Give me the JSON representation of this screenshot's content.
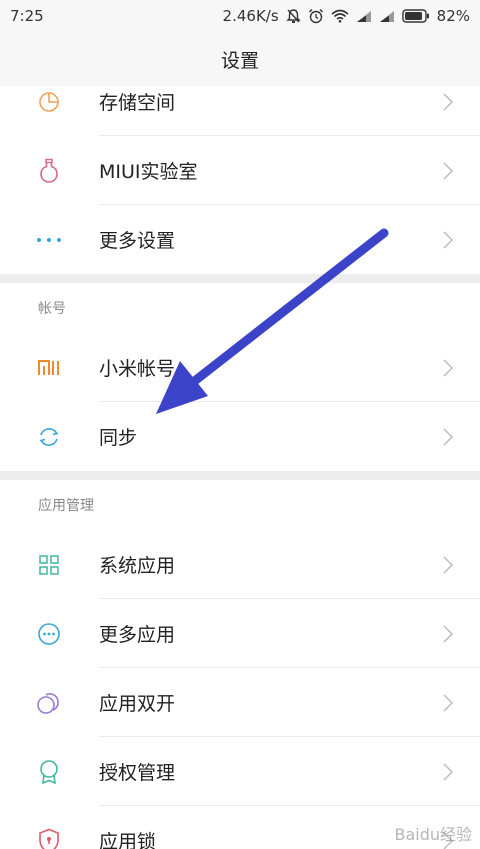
{
  "status_bar": {
    "time": "7:25",
    "network_speed": "2.46K/s",
    "battery": "82%",
    "icons": [
      "mute-icon",
      "alarm-icon",
      "wifi-icon",
      "signal-icon",
      "signal-icon",
      "battery-icon"
    ]
  },
  "header": {
    "title": "设置"
  },
  "groups": {
    "top": {
      "items": [
        {
          "label": "存储空间",
          "icon": "storage-icon"
        },
        {
          "label": "MIUI实验室",
          "icon": "lab-flask-icon"
        },
        {
          "label": "更多设置",
          "icon": "more-dots-icon"
        }
      ]
    },
    "account": {
      "header": "帐号",
      "items": [
        {
          "label": "小米帐号",
          "icon": "mi-logo-icon"
        },
        {
          "label": "同步",
          "icon": "sync-icon"
        }
      ]
    },
    "apps": {
      "header": "应用管理",
      "items": [
        {
          "label": "系统应用",
          "icon": "grid-icon"
        },
        {
          "label": "更多应用",
          "icon": "more-apps-icon"
        },
        {
          "label": "应用双开",
          "icon": "dual-apps-icon"
        },
        {
          "label": "授权管理",
          "icon": "permission-badge-icon"
        },
        {
          "label": "应用锁",
          "icon": "app-lock-icon"
        }
      ]
    }
  },
  "colors": {
    "arrow": "#3b43c9",
    "storage_icon": "#f0a15a",
    "lab_icon": "#d46a8c",
    "dots_icon": "#3aa7d6",
    "mi_icon": "#f08b2d",
    "sync_icon": "#3aa7d6",
    "grid_icon": "#3fb89b",
    "more_apps_icon": "#3aa7d6",
    "dual_icon": "#9b7ad6",
    "permission_icon": "#3fb89b",
    "lock_icon": "#e05a6a"
  },
  "watermark": "Baidu经验"
}
